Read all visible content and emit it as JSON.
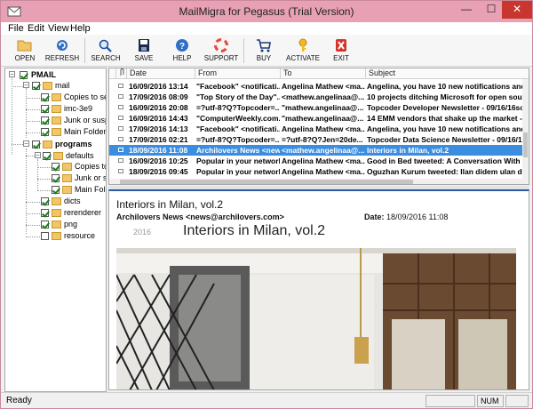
{
  "window": {
    "title": "MailMigra for Pegasus (Trial Version)",
    "min_glyph": "—",
    "max_glyph": "☐",
    "close_glyph": "✕"
  },
  "menu": [
    "File",
    "Edit",
    "View",
    "Help"
  ],
  "toolbar": [
    {
      "label": "OPEN",
      "icon": "open-folder-icon"
    },
    {
      "label": "REFRESH",
      "icon": "refresh-icon"
    },
    {
      "label": "SEARCH",
      "icon": "search-icon"
    },
    {
      "label": "SAVE",
      "icon": "save-icon"
    },
    {
      "label": "HELP",
      "icon": "help-icon"
    },
    {
      "label": "SUPPORT",
      "icon": "support-lifebuoy-icon"
    },
    {
      "label": "BUY",
      "icon": "cart-icon"
    },
    {
      "label": "ACTIVATE",
      "icon": "key-icon"
    },
    {
      "label": "EXIT",
      "icon": "exit-icon"
    }
  ],
  "tree": {
    "root": {
      "label": "PMAIL"
    },
    "items": [
      {
        "label": "mail",
        "checked": true,
        "bold": false
      },
      {
        "label": "Copies to self",
        "checked": true,
        "bold": false
      },
      {
        "label": "imc-3e9",
        "checked": true,
        "bold": false
      },
      {
        "label": "Junk or suspici",
        "checked": true,
        "bold": false
      },
      {
        "label": "Main Folder",
        "checked": true,
        "bold": false
      },
      {
        "label": "programs",
        "checked": true,
        "bold": true
      },
      {
        "label": "defaults",
        "checked": true,
        "bold": false
      },
      {
        "label": "Copies to s",
        "checked": true,
        "bold": false
      },
      {
        "label": "Junk or sus",
        "checked": true,
        "bold": false
      },
      {
        "label": "Main Folde",
        "checked": true,
        "bold": false
      },
      {
        "label": "dicts",
        "checked": true,
        "bold": false
      },
      {
        "label": "rerenderer",
        "checked": true,
        "bold": false
      },
      {
        "label": "png",
        "checked": true,
        "bold": false
      },
      {
        "label": "resource",
        "checked": false,
        "bold": false
      }
    ]
  },
  "mail_list": {
    "columns": [
      "Date",
      "From",
      "To",
      "Subject"
    ],
    "rows": [
      {
        "date": "16/09/2016 13:14",
        "from": "\"Facebook\" <notificati...",
        "to": "Angelina Mathew <ma...",
        "subject": "Angelina, you have 10 new notifications and 1 n",
        "selected": false
      },
      {
        "date": "17/09/2016 08:09",
        "from": "\"Top Story of the Day\"...",
        "to": "<mathew.angelinaa@...",
        "subject": "10 projects ditching Microsoft for open source--",
        "selected": false
      },
      {
        "date": "16/09/2016 20:08",
        "from": "=?utf-8?Q?Topcoder=...",
        "to": "\"mathew.angelinaa@...",
        "subject": "Topcoder Developer Newsletter - 09/16/16sou",
        "selected": false
      },
      {
        "date": "16/09/2016 14:43",
        "from": "\"ComputerWeekly.com...",
        "to": "\"mathew.angelinaa@...",
        "subject": "14 EMM vendors that shake up the market - an",
        "selected": false
      },
      {
        "date": "17/09/2016 14:13",
        "from": "\"Facebook\" <notificati...",
        "to": "Angelina Mathew <ma...",
        "subject": "Angelina, you have 10 new notifications and 1 n",
        "selected": false
      },
      {
        "date": "17/09/2016 02:21",
        "from": "=?utf-8?Q?Topcoder=...",
        "to": "=?utf-8?Q?Jen=20de...",
        "subject": "Topcoder Data Science Newsletter - 09/16/16s",
        "selected": false
      },
      {
        "date": "18/09/2016 11:08",
        "from": "Archilovers News <new...",
        "to": "<mathew.angelinaa@...",
        "subject": "Interiors in Milan, vol.2",
        "selected": true
      },
      {
        "date": "16/09/2016 10:25",
        "from": "Popular in your network...",
        "to": "Angelina Mathew <ma...",
        "subject": "Good in Bed tweeted: A Conversation With My F",
        "selected": false
      },
      {
        "date": "18/09/2016 09:45",
        "from": "Popular in your network...",
        "to": "Angelina Mathew <ma...",
        "subject": "Oguzhan Kurum tweeted: Ilan didem ulan d",
        "selected": false
      }
    ]
  },
  "preview": {
    "subject": "Interiors in Milan, vol.2",
    "from": "Archilovers News <news@archilovers.com>",
    "date_label": "Date:",
    "date": "18/09/2016 11:08",
    "body_year": "2016",
    "body_heading": "Interiors in Milan, vol.2"
  },
  "status": {
    "text": "Ready",
    "num": "NUM"
  },
  "colors": {
    "titlebar": "#e8a0b4",
    "selection": "#3b8de0",
    "close": "#c7362f"
  }
}
